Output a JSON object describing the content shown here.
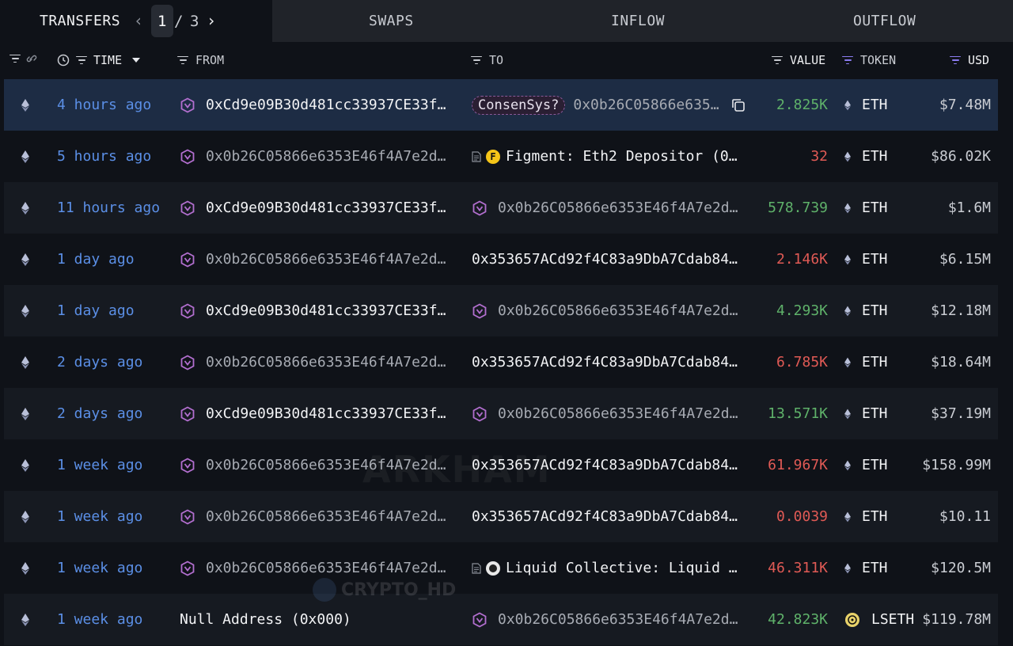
{
  "tabs": {
    "transfers": "TRANSFERS",
    "swaps": "SWAPS",
    "inflow": "INFLOW",
    "outflow": "OUTFLOW"
  },
  "pager": {
    "current": "1",
    "separator": "/",
    "total": "3",
    "prev": "‹",
    "next": "›"
  },
  "columns": {
    "time": "TIME",
    "from": "FROM",
    "to": "TO",
    "value": "VALUE",
    "token": "TOKEN",
    "usd": "USD"
  },
  "colors": {
    "green": "#5fb26a",
    "red": "#e05a55",
    "link": "#5b8fe6",
    "selected_row": "#1d2c44"
  },
  "rows": [
    {
      "time": "4 hours ago",
      "from": "0xCd9e09B30d481cc33937CE33f…",
      "from_entity": true,
      "from_bright": true,
      "to_tag": "ConsenSys?",
      "to": "0x0b26C05866e635…",
      "to_bright": false,
      "to_entity": false,
      "to_copy": true,
      "value": "2.825K",
      "value_color": "green",
      "token": "ETH",
      "usd": "$7.48M"
    },
    {
      "time": "5 hours ago",
      "from": "0x0b26C05866e6353E46f4A7e2d…",
      "from_entity": true,
      "from_bright": false,
      "to_badge": "F",
      "to": "Figment: Eth2 Depositor (0…",
      "to_bright": true,
      "to_doc": true,
      "value": "32",
      "value_color": "red",
      "token": "ETH",
      "usd": "$86.02K"
    },
    {
      "time": "11 hours ago",
      "from": "0xCd9e09B30d481cc33937CE33f…",
      "from_entity": true,
      "from_bright": true,
      "to": "0x0b26C05866e6353E46f4A7e2d…",
      "to_entity": true,
      "to_bright": false,
      "value": "578.739",
      "value_color": "green",
      "token": "ETH",
      "usd": "$1.6M"
    },
    {
      "time": "1 day ago",
      "from": "0x0b26C05866e6353E46f4A7e2d…",
      "from_entity": true,
      "from_bright": false,
      "to": "0x353657ACd92f4C83a9DbA7Cdab84…",
      "to_bright": true,
      "value": "2.146K",
      "value_color": "red",
      "token": "ETH",
      "usd": "$6.15M"
    },
    {
      "time": "1 day ago",
      "from": "0xCd9e09B30d481cc33937CE33f…",
      "from_entity": true,
      "from_bright": true,
      "to": "0x0b26C05866e6353E46f4A7e2d…",
      "to_entity": true,
      "to_bright": false,
      "value": "4.293K",
      "value_color": "green",
      "token": "ETH",
      "usd": "$12.18M"
    },
    {
      "time": "2 days ago",
      "from": "0x0b26C05866e6353E46f4A7e2d…",
      "from_entity": true,
      "from_bright": false,
      "to": "0x353657ACd92f4C83a9DbA7Cdab84…",
      "to_bright": true,
      "value": "6.785K",
      "value_color": "red",
      "token": "ETH",
      "usd": "$18.64M"
    },
    {
      "time": "2 days ago",
      "from": "0xCd9e09B30d481cc33937CE33f…",
      "from_entity": true,
      "from_bright": true,
      "to": "0x0b26C05866e6353E46f4A7e2d…",
      "to_entity": true,
      "to_bright": false,
      "value": "13.571K",
      "value_color": "green",
      "token": "ETH",
      "usd": "$37.19M"
    },
    {
      "time": "1 week ago",
      "from": "0x0b26C05866e6353E46f4A7e2d…",
      "from_entity": true,
      "from_bright": false,
      "to": "0x353657ACd92f4C83a9DbA7Cdab84…",
      "to_bright": true,
      "value": "61.967K",
      "value_color": "red",
      "token": "ETH",
      "usd": "$158.99M"
    },
    {
      "time": "1 week ago",
      "from": "0x0b26C05866e6353E46f4A7e2d…",
      "from_entity": true,
      "from_bright": false,
      "to": "0x353657ACd92f4C83a9DbA7Cdab84…",
      "to_bright": true,
      "value": "0.0039",
      "value_color": "red",
      "token": "ETH",
      "usd": "$10.11"
    },
    {
      "time": "1 week ago",
      "from": "0x0b26C05866e6353E46f4A7e2d…",
      "from_entity": true,
      "from_bright": false,
      "to_badge": "lc",
      "to": "Liquid Collective: Liquid …",
      "to_bright": true,
      "to_doc": true,
      "value": "46.311K",
      "value_color": "red",
      "token": "ETH",
      "usd": "$120.5M"
    },
    {
      "time": "1 week ago",
      "from": "Null Address (0x000)",
      "from_entity": false,
      "from_bright": true,
      "to": "0x0b26C05866e6353E46f4A7e2d…",
      "to_entity": true,
      "to_bright": false,
      "value": "42.823K",
      "value_color": "green",
      "token": "LSETH",
      "token_icon": "lseth",
      "usd": "$119.78M"
    }
  ],
  "watermarks": {
    "arkham": "ARKHAM",
    "crypto": "CRYPTO_HD"
  }
}
